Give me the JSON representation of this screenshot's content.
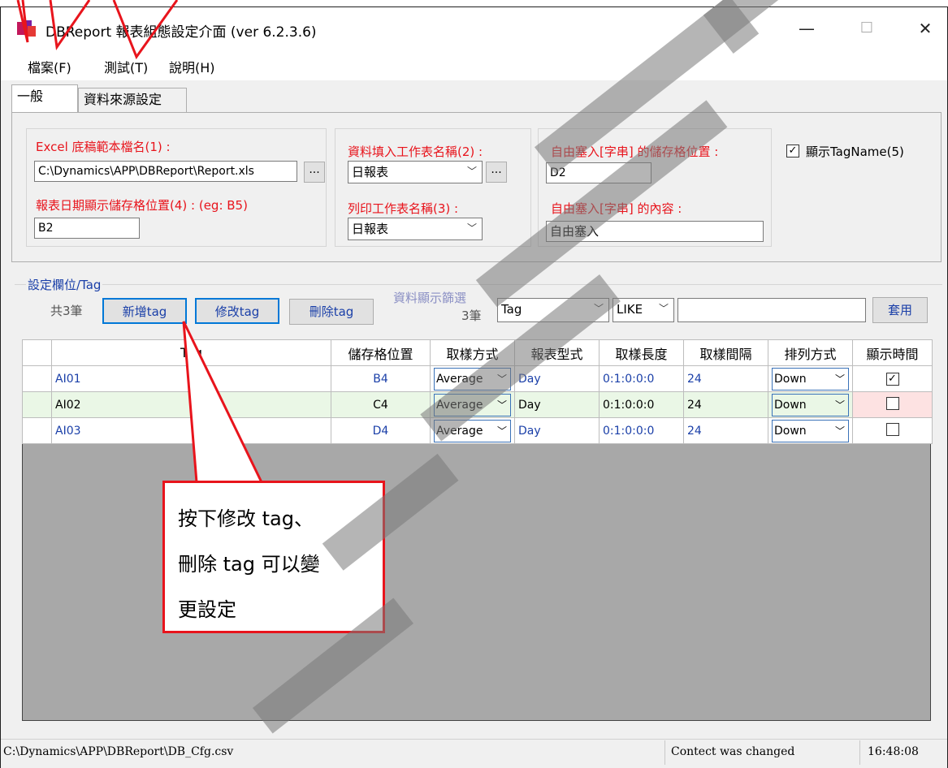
{
  "window": {
    "title": "DBReport 報表組態設定介面 (ver 6.2.3.6)",
    "minimize": "—",
    "maximize": "☐",
    "close": "✕"
  },
  "menu": [
    "檔案(F)",
    "測試(T)",
    "說明(H)"
  ],
  "tabs": [
    "一般",
    "資料來源設定"
  ],
  "general": {
    "excel_label": "Excel 底稿範本檔名(1) :",
    "excel_value": "C:\\Dynamics\\APP\\DBReport\\Report.xls",
    "browse": "...",
    "date_label": "報表日期顯示儲存格位置(4) : (eg: B5)",
    "date_value": "B2",
    "fill_sheet_label": "資料填入工作表名稱(2) :",
    "fill_sheet_value": "日報表",
    "print_sheet_label": "列印工作表名稱(3) :",
    "print_sheet_value": "日報表",
    "free_pos_label": "自由塞入[字串] 的儲存格位置 :",
    "free_pos_value": "D2",
    "free_content_label": "自由塞入[字串] 的內容 :",
    "free_content_value": "自由塞入",
    "show_tagname_label": "顯示TagName(5)",
    "show_tagname_checked": true
  },
  "tag_section": {
    "title": "設定欄位/Tag",
    "count": "共3筆",
    "add": "新增tag",
    "modify": "修改tag",
    "delete": "刪除tag",
    "filter_label": "資料顯示篩選",
    "filter_count": "3筆",
    "filter_field": "Tag",
    "filter_op": "LIKE",
    "filter_value": "",
    "apply": "套用"
  },
  "grid": {
    "columns": [
      "Tag",
      "儲存格位置",
      "取樣方式",
      "報表型式",
      "取樣長度",
      "取樣間隔",
      "排列方式",
      "顯示時間"
    ],
    "rows": [
      {
        "tag": "AI01",
        "cell": "B4",
        "method": "Average",
        "type": "Day",
        "length": "0:1:0:0:0",
        "interval": "24",
        "order": "Down",
        "show_time": true
      },
      {
        "tag": "AI02",
        "cell": "C4",
        "method": "Average",
        "type": "Day",
        "length": "0:1:0:0:0",
        "interval": "24",
        "order": "Down",
        "show_time": false
      },
      {
        "tag": "AI03",
        "cell": "D4",
        "method": "Average",
        "type": "Day",
        "length": "0:1:0:0:0",
        "interval": "24",
        "order": "Down",
        "show_time": false
      }
    ]
  },
  "status": {
    "path": "C:\\Dynamics\\APP\\DBReport\\DB_Cfg.csv",
    "message": "Contect was changed",
    "time": "16:48:08"
  },
  "callout": {
    "line1": "按下修改 tag、",
    "line2": "刪除 tag 可以變",
    "line3": "更設定"
  },
  "colors": {
    "accent_red": "#e8141c",
    "link_blue": "#1a3fa8",
    "focus_blue": "#0078d7",
    "row_green": "#eaf7e6",
    "row_pink": "#fde2e2"
  }
}
